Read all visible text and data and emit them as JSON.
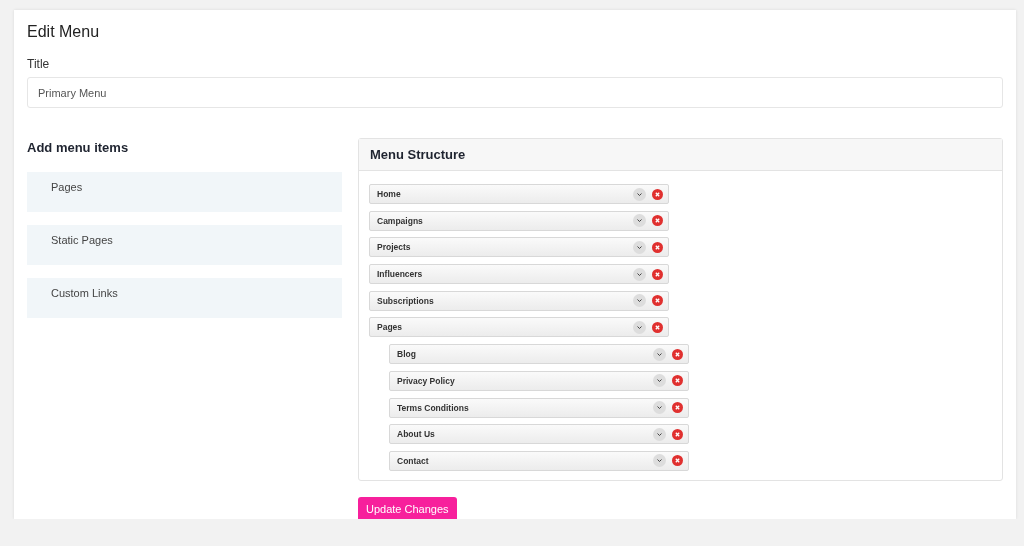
{
  "page": {
    "title": "Edit Menu"
  },
  "title_field": {
    "label": "Title",
    "value": "Primary Menu"
  },
  "add_menu_items": {
    "heading": "Add menu items",
    "sections": [
      "Pages",
      "Static Pages",
      "Custom Links"
    ]
  },
  "menu_structure": {
    "heading": "Menu Structure",
    "items": [
      {
        "label": "Home"
      },
      {
        "label": "Campaigns"
      },
      {
        "label": "Projects"
      },
      {
        "label": "Influencers"
      },
      {
        "label": "Subscriptions"
      },
      {
        "label": "Pages",
        "children": [
          {
            "label": "Blog"
          },
          {
            "label": "Privacy Policy"
          },
          {
            "label": "Terms Conditions"
          },
          {
            "label": "About Us"
          },
          {
            "label": "Contact"
          }
        ]
      }
    ]
  },
  "submit_button": "Update Changes"
}
